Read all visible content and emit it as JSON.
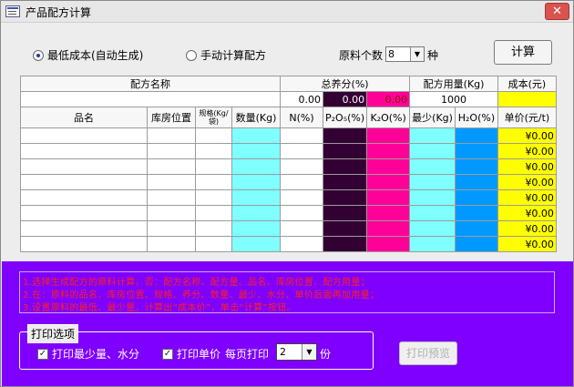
{
  "window": {
    "title": "产品配方计算",
    "close_glyph": "✕"
  },
  "options": {
    "radio_min_cost": "最低成本(自动生成)",
    "radio_manual": "手动计算配方",
    "count_label": "原料个数",
    "count_value": "8",
    "count_unit": "种",
    "calc_button": "计算"
  },
  "table": {
    "head1": {
      "formula_name": "配方名称",
      "total_nutrient": "总养分(%)",
      "formula_amount": "配方用量(Kg)",
      "cost": "成本(元)"
    },
    "summary": {
      "n_total": "0.00",
      "p_total": "0.00",
      "k_total": "0.00",
      "amount": "1000",
      "cost": ""
    },
    "columns": {
      "name": "品名",
      "location": "库房位置",
      "spec": "规格(Kg/袋)",
      "qty": "数量(Kg)",
      "n": "N(%)",
      "p": "P₂O₅(%)",
      "k": "K₂O(%)",
      "min": "最少(Kg)",
      "water": "H₂O(%)",
      "price": "单价(元/t)"
    },
    "rows": [
      {
        "price": "¥0.00"
      },
      {
        "price": "¥0.00"
      },
      {
        "price": "¥0.00"
      },
      {
        "price": "¥0.00"
      },
      {
        "price": "¥0.00"
      },
      {
        "price": "¥0.00"
      },
      {
        "price": "¥0.00"
      },
      {
        "price": "¥0.00"
      }
    ]
  },
  "notes": [
    "1.选择生成配方的原料计算，否：配方名称、配方量、品名、库房位置、配方用量；",
    "2.在：原料的品名、库房位置、规格、养分、数量、最少、水分、单价后面再加用量；",
    "3.设置原料的最低、最少量，计算出“成本价”，单击“计算”按钮。"
  ],
  "print_options": {
    "group_title": "打印选项",
    "print_min_water": "打印最少量、水分",
    "print_price": "打印单价",
    "copies_label": "每页打印",
    "copies_value": "2",
    "copies_unit": "份",
    "preview_button": "打印预览"
  },
  "colors": {
    "cyan": "#80ffff",
    "dark_purple": "#330033",
    "magenta": "#ff0099",
    "blue": "#0099ff",
    "yellow": "#ffff00",
    "panel_purple": "#7f00ff"
  }
}
